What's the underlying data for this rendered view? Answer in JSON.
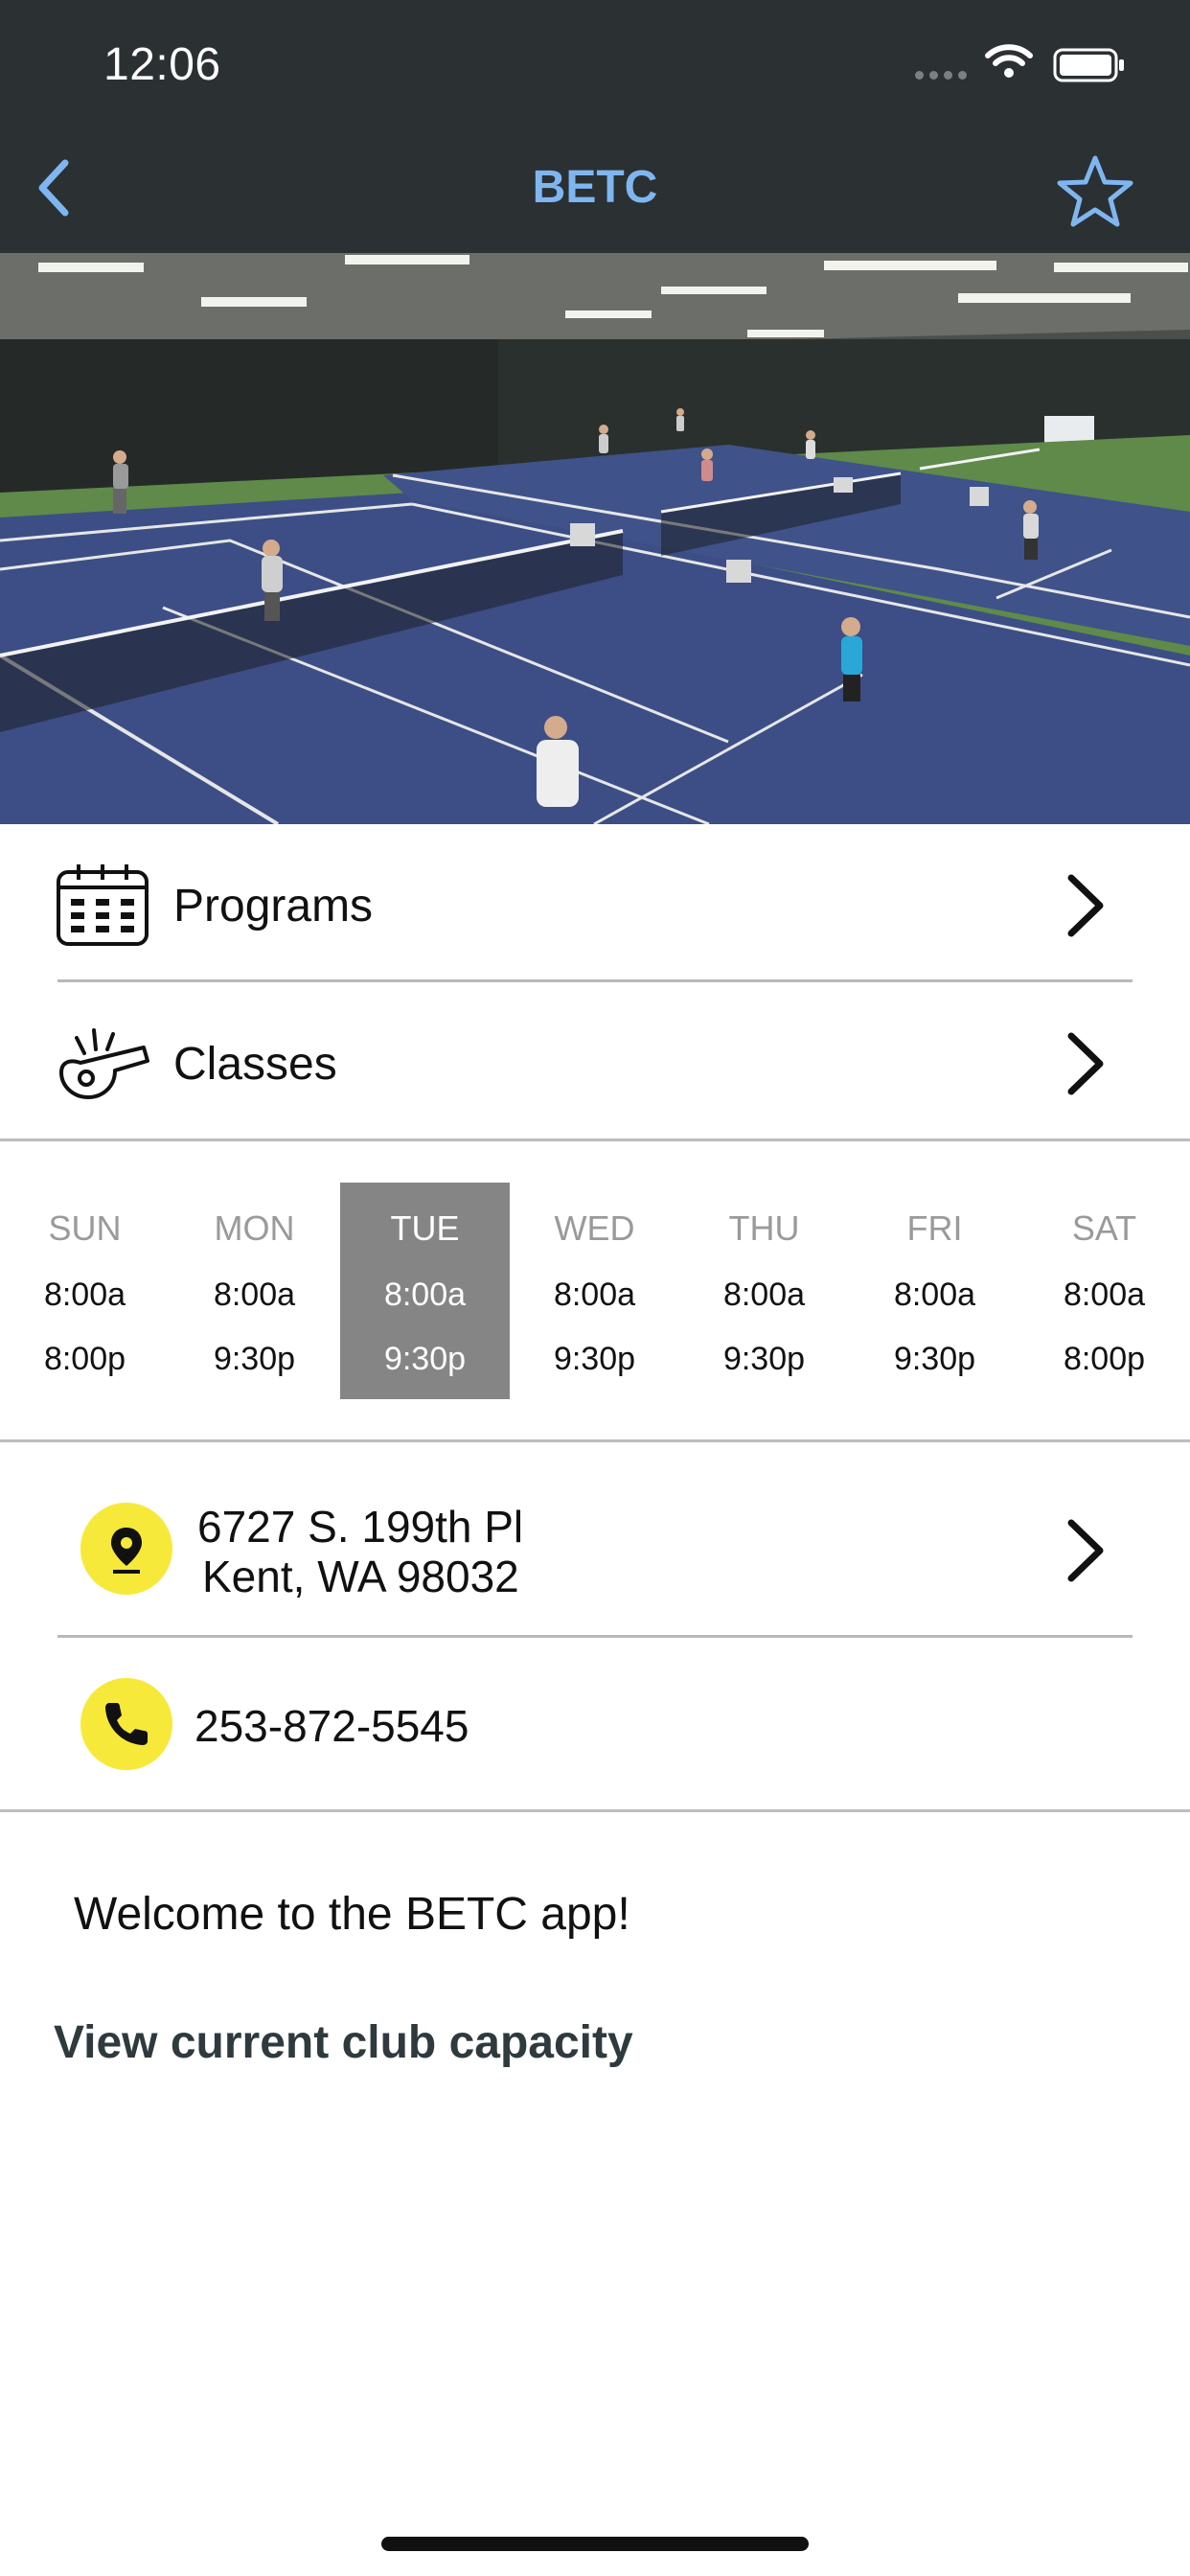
{
  "status_bar": {
    "time": "12:06"
  },
  "nav": {
    "title": "BETC",
    "back_icon": "chevron-left-icon",
    "favorite_icon": "star-outline-icon"
  },
  "hero": {
    "alt": "indoor tennis courts"
  },
  "menu": [
    {
      "label": "Programs",
      "icon": "calendar-icon"
    },
    {
      "label": "Classes",
      "icon": "whistle-icon"
    }
  ],
  "hours": [
    {
      "day": "SUN",
      "open": "8:00a",
      "close": "8:00p"
    },
    {
      "day": "MON",
      "open": "8:00a",
      "close": "9:30p"
    },
    {
      "day": "TUE",
      "open": "8:00a",
      "close": "9:30p",
      "active": true
    },
    {
      "day": "WED",
      "open": "8:00a",
      "close": "9:30p"
    },
    {
      "day": "THU",
      "open": "8:00a",
      "close": "9:30p"
    },
    {
      "day": "FRI",
      "open": "8:00a",
      "close": "9:30p"
    },
    {
      "day": "SAT",
      "open": "8:00a",
      "close": "8:00p"
    }
  ],
  "contact": {
    "address_line1": "6727 S. 199th Pl",
    "address_line2": "Kent, WA 98032",
    "phone": "253-872-5545"
  },
  "welcome": "Welcome to the BETC app!",
  "capacity_link": "View current club capacity",
  "colors": {
    "topbar": "#2b3033",
    "accent": "#7fb6f0",
    "badge": "#f7e93a",
    "active_day": "#858585"
  }
}
